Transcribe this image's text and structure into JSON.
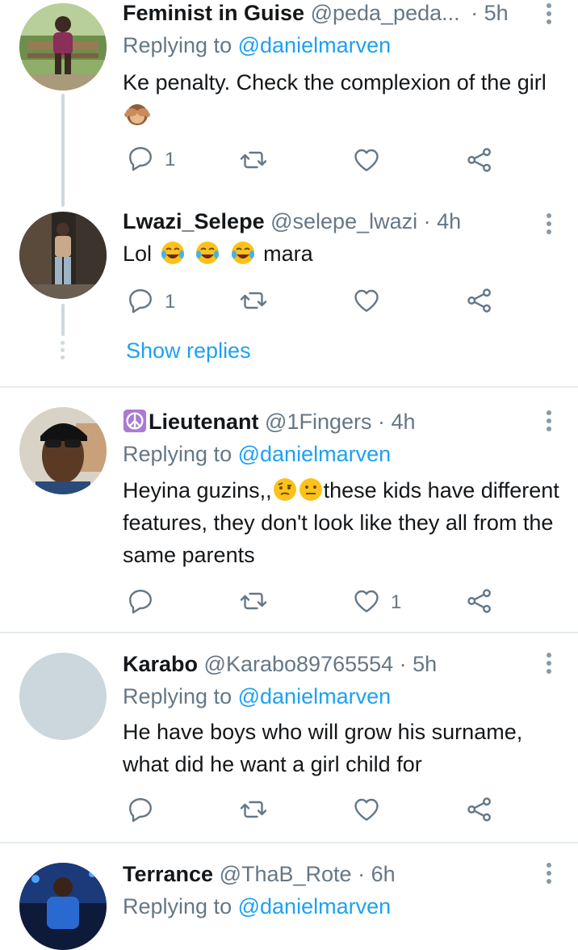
{
  "tweets": [
    {
      "name": "Feminist in Guise",
      "handle": "@peda_peda...",
      "time": "· 5h",
      "replying_prefix": "Replying to",
      "replying_to": "@danielmarven",
      "text": "Ke penalty. Check the complexion of the girl",
      "emoji": [
        "see-no-evil-monkey"
      ],
      "reply_count": "1",
      "retweet_count": "",
      "like_count": ""
    },
    {
      "name": "Lwazi_Selepe",
      "handle": "@selepe_lwazi",
      "time": "· 4h",
      "text_before": "Lol",
      "text_after": "mara",
      "emoji": [
        "tears-of-joy",
        "tears-of-joy",
        "tears-of-joy"
      ],
      "reply_count": "1",
      "retweet_count": "",
      "like_count": ""
    },
    {
      "name_emoji": "peace-symbol",
      "name": "Lieutenant",
      "handle": "@1Fingers",
      "time": "· 4h",
      "replying_prefix": "Replying to",
      "replying_to": "@danielmarven",
      "text_before": "Heyina guzins,,",
      "text_after": "these kids have different  features, they don't look  like they all from the same parents",
      "emoji": [
        "face-with-raised-eyebrow",
        "neutral-face"
      ],
      "reply_count": "",
      "retweet_count": "",
      "like_count": "1"
    },
    {
      "name": "Karabo",
      "handle": "@Karabo89765554",
      "time": "· 5h",
      "replying_prefix": "Replying to",
      "replying_to": "@danielmarven",
      "text": "He have boys who will grow his surname, what did he want a girl child for",
      "reply_count": "",
      "retweet_count": "",
      "like_count": ""
    },
    {
      "name": "Terrance",
      "handle": "@ThaB_Rote",
      "time": "· 6h",
      "replying_prefix": "Replying to",
      "replying_to": "@danielmarven"
    }
  ],
  "show_replies": "Show replies",
  "colors": {
    "accent": "#1da1f2",
    "secondary_text": "#657786",
    "icon": "#657786",
    "divider": "#e6ecf0",
    "thread_line": "#cfd9de"
  },
  "icons": [
    "reply-icon",
    "retweet-icon",
    "like-icon",
    "share-icon",
    "more-options-icon"
  ]
}
